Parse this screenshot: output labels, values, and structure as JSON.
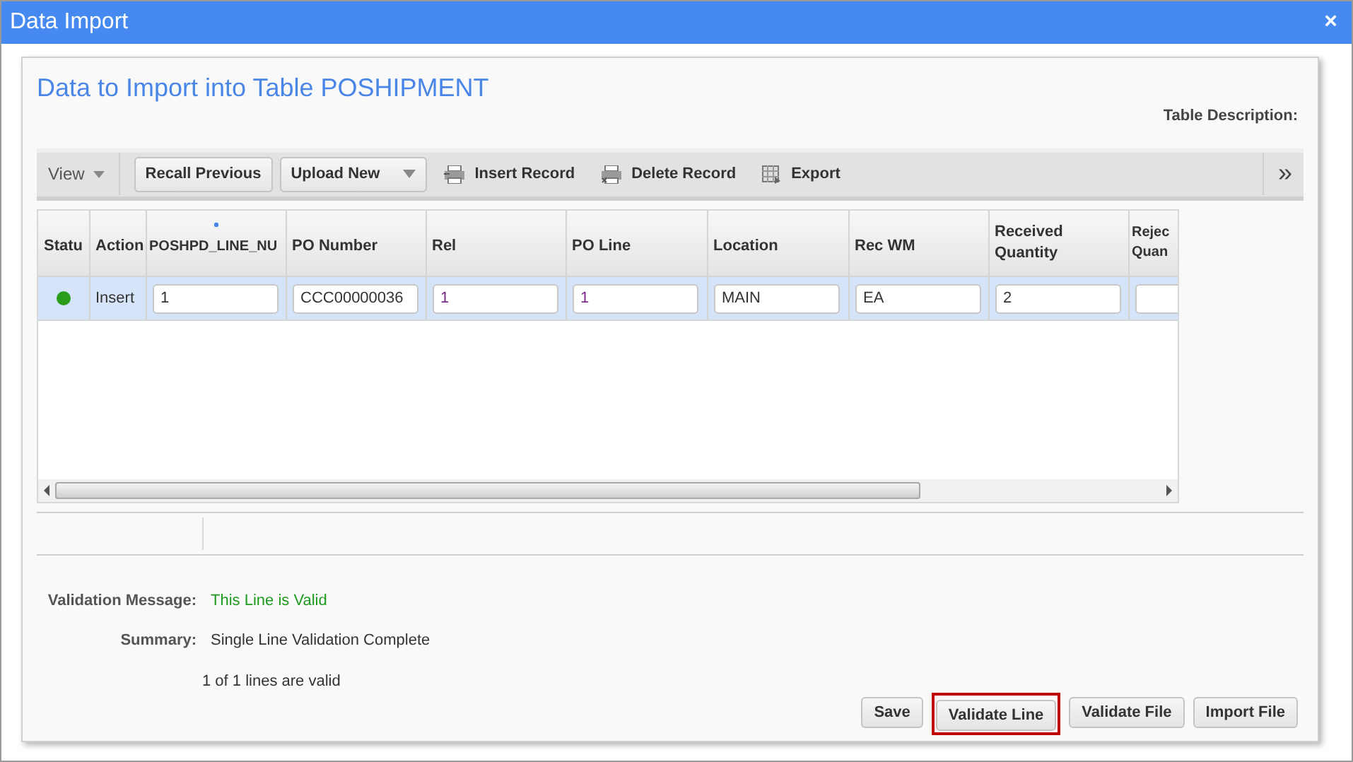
{
  "window": {
    "title": "Data Import",
    "close": "×"
  },
  "heading": "Data to Import into Table POSHIPMENT",
  "table_description_label": "Table Description:",
  "toolbar": {
    "view": "View",
    "items": [
      {
        "kind": "button",
        "label": "Recall Previous"
      },
      {
        "kind": "dropdown",
        "label": "Upload New"
      },
      {
        "kind": "insert",
        "label": "Insert Record"
      },
      {
        "kind": "delete",
        "label": "Delete Record"
      },
      {
        "kind": "export",
        "label": "Export"
      }
    ],
    "more": "»"
  },
  "table": {
    "columns": [
      {
        "label": "Statu",
        "required": false
      },
      {
        "label": "Action",
        "required": false
      },
      {
        "label": "POSHPD_LINE_NU",
        "required": true
      },
      {
        "label": "PO Number",
        "required": false
      },
      {
        "label": "Rel",
        "required": false
      },
      {
        "label": "PO Line",
        "required": false
      },
      {
        "label": "Location",
        "required": false
      },
      {
        "label": "Rec WM",
        "required": false
      },
      {
        "label": "Received Quantity",
        "required": false
      },
      {
        "label": "Rejec Quan",
        "required": false
      }
    ],
    "rows": [
      {
        "selected": true,
        "color": "#2a9d1a",
        "action": "Insert",
        "values": [
          "1",
          "CCC00000036",
          "1",
          "1",
          "MAIN",
          "EA",
          "2"
        ]
      }
    ]
  },
  "validation": [
    {
      "label": "Validation Message:",
      "value": "This Line is Valid",
      "kind": "success"
    },
    {
      "label": "Summary:",
      "value": "Single Line Validation Complete",
      "kind": "plain"
    },
    {
      "value": "1 of 1 lines are valid",
      "kind": "plain"
    }
  ],
  "buttons": [
    {
      "label": "Save",
      "highlighted": false
    },
    {
      "label": "Validate Line",
      "highlighted": true
    },
    {
      "label": "Validate File",
      "highlighted": false
    },
    {
      "label": "Import File",
      "highlighted": false
    }
  ]
}
